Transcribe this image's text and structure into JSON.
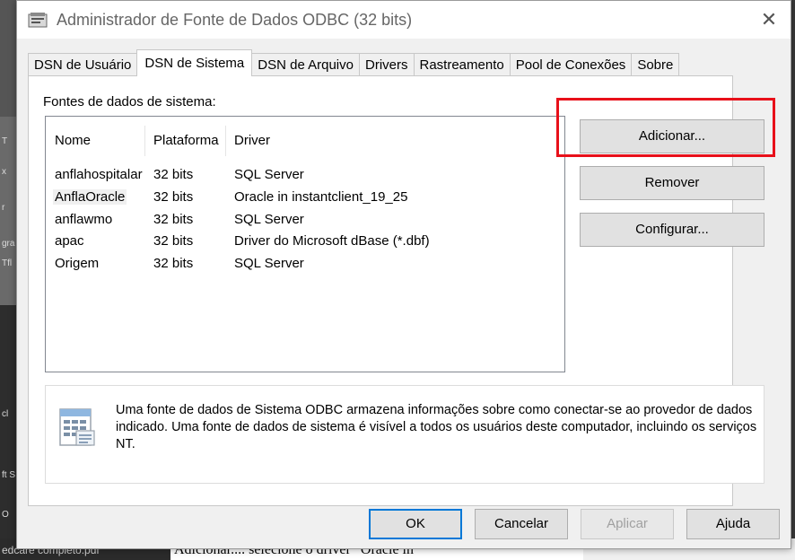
{
  "background": {
    "left_snippets": [
      "T",
      "x",
      "r",
      "gra",
      "Tfl",
      "cl",
      "ft S",
      "O"
    ],
    "bottom_left_text": "edcare completo.pdf",
    "doc_text": "Adicionar.... selecione o driver “Oracle in"
  },
  "window": {
    "title": "Administrador de Fonte de Dados ODBC (32 bits)",
    "close_glyph": "✕"
  },
  "tabs": [
    {
      "label": "DSN de Usuário",
      "active": false
    },
    {
      "label": "DSN de Sistema",
      "active": true
    },
    {
      "label": "DSN de Arquivo",
      "active": false
    },
    {
      "label": "Drivers",
      "active": false
    },
    {
      "label": "Rastreamento",
      "active": false
    },
    {
      "label": "Pool de Conexões",
      "active": false
    },
    {
      "label": "Sobre",
      "active": false
    }
  ],
  "panel": {
    "label": "Fontes de dados de sistema:",
    "columns": [
      "Nome",
      "Plataforma",
      "Driver"
    ],
    "rows": [
      {
        "name": "anflahospitalar",
        "platform": "32 bits",
        "driver": "SQL Server",
        "selected": false
      },
      {
        "name": "AnflaOracle",
        "platform": "32 bits",
        "driver": "Oracle in instantclient_19_25",
        "selected": true
      },
      {
        "name": "anflawmo",
        "platform": "32 bits",
        "driver": "SQL Server",
        "selected": false
      },
      {
        "name": "apac",
        "platform": "32 bits",
        "driver": "Driver do Microsoft dBase (*.dbf)",
        "selected": false
      },
      {
        "name": "Origem",
        "platform": "32 bits",
        "driver": "SQL Server",
        "selected": false
      }
    ],
    "buttons": {
      "add": "Adicionar...",
      "remove": "Remover",
      "configure": "Configurar..."
    },
    "info_text": "Uma fonte de dados de Sistema ODBC armazena informações sobre como conectar-se ao provedor de dados indicado. Uma fonte de dados de sistema é visível a todos os usuários deste computador, incluindo os serviços NT."
  },
  "footer": {
    "ok": "OK",
    "cancel": "Cancelar",
    "apply": "Aplicar",
    "help": "Ajuda"
  },
  "colors": {
    "highlight": "#e8101a",
    "default_button_border": "#0078d7"
  }
}
